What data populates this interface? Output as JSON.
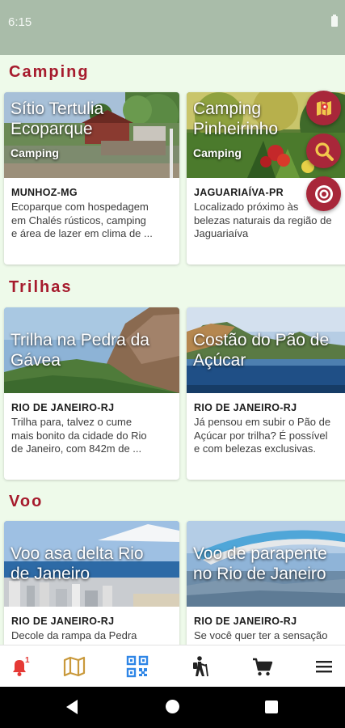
{
  "status_bar": {
    "time": "6:15"
  },
  "sections": {
    "camping": {
      "title": "Camping",
      "cards": [
        {
          "title": "Sítio Tertulia\nEcoparque",
          "badge": "Camping",
          "location": "MUNHOZ-MG",
          "description": "Ecoparque com hospedagem\nem Chalés rústicos, camping\ne área de lazer em clima de ..."
        },
        {
          "title": "Camping\nPinheirinho",
          "badge": "Camping",
          "location": "JAGUARIAÍVA-PR",
          "description": "Localizado próximo às\nbelezas naturais da região de\nJaguariaíva"
        }
      ]
    },
    "trilhas": {
      "title": "Trilhas",
      "cards": [
        {
          "title": "Trilha na Pedra da\nGávea",
          "location": "RIO DE JANEIRO-RJ",
          "description": "Trilha para, talvez o cume\nmais bonito da cidade do Rio\nde Janeiro, com 842m de ..."
        },
        {
          "title": "Costão do Pão de\nAçúcar",
          "location": "RIO DE JANEIRO-RJ",
          "description": "Já pensou em subir o Pão de\nAçúcar por trilha? É possível\ne com belezas exclusivas."
        }
      ]
    },
    "voo": {
      "title": "Voo",
      "cards": [
        {
          "title": "Voo asa delta Rio\nde Janeiro",
          "location": "RIO DE JANEIRO-RJ",
          "description": "Decole da rampa da Pedra"
        },
        {
          "title": "Voo de parapente\nno Rio de Janeiro",
          "location": "RIO DE JANEIRO-RJ",
          "description": "Se você quer ter a sensação"
        }
      ]
    }
  },
  "fab_buttons": [
    "map-pin-icon",
    "search-icon",
    "target-icon"
  ],
  "bottom_nav": [
    "bell-icon",
    "map-icon",
    "qr-code-icon",
    "hiking-icon",
    "cart-icon",
    "menu-icon"
  ],
  "colors": {
    "accent": "#a61b2d",
    "fab": "#a8273a",
    "background": "#eefaea",
    "status_bar": "#a9bca9",
    "nav_map": "#c9993b",
    "nav_qr": "#2f86e6"
  }
}
